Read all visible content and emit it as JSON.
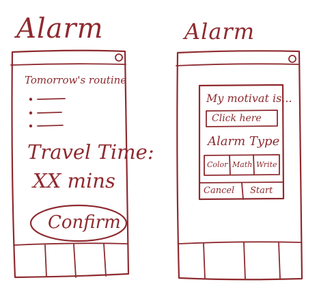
{
  "colors": {
    "ink": "#8e2a2f",
    "paper": "#ffffff"
  },
  "left_screen": {
    "title": "Alarm",
    "routine_heading": "Tomorrow's routine",
    "bullet_count": 3,
    "travel_label": "Travel Time:",
    "travel_value": "XX mins",
    "confirm_label": "Confirm",
    "tab_count": 4
  },
  "right_screen": {
    "title": "Alarm",
    "motivation_label": "My motivat is...",
    "input_placeholder": "Click here",
    "alarm_type_label": "Alarm Type",
    "type_options": [
      "Color",
      "Math",
      "Write"
    ],
    "cancel_label": "Cancel",
    "start_label": "Start",
    "tab_count": 4
  }
}
